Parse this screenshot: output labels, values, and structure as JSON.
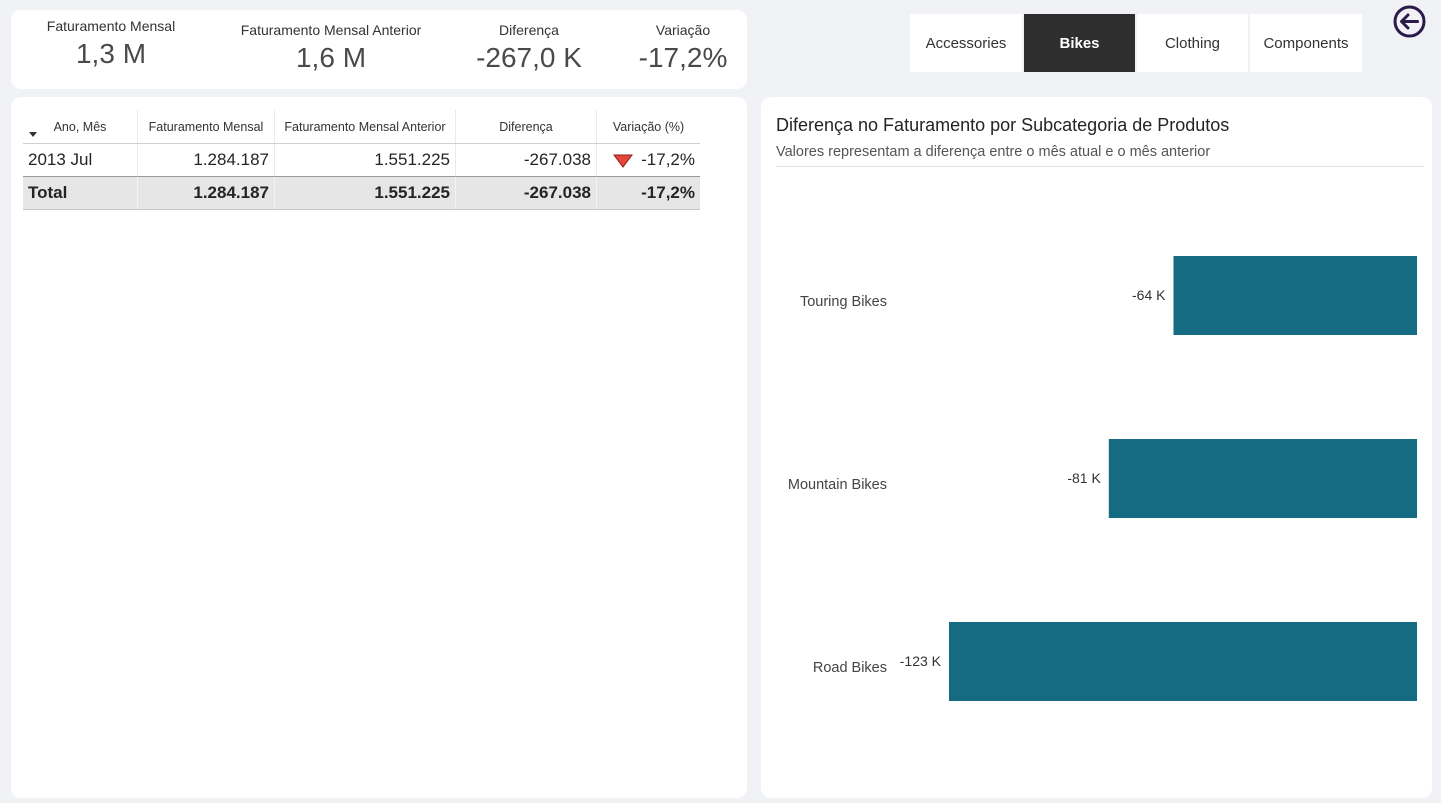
{
  "kpis": [
    {
      "label": "Faturamento Mensal",
      "value": "1,3 M"
    },
    {
      "label": "Faturamento Mensal Anterior",
      "value": "1,6 M"
    },
    {
      "label": "Diferença",
      "value": "-267,0 K"
    },
    {
      "label": "Variação",
      "value": "-17,2%"
    }
  ],
  "category_slicer": {
    "options": [
      "Accessories",
      "Bikes",
      "Clothing",
      "Components"
    ],
    "selected": "Bikes"
  },
  "back_button": {
    "icon": "arrow-left-circle-icon",
    "color": "#2b1a4a"
  },
  "table": {
    "headers": [
      "Ano, Mês",
      "Faturamento Mensal",
      "Faturamento Mensal Anterior",
      "Diferença",
      "Variação (%)"
    ],
    "rows": [
      {
        "period": "2013 Jul",
        "revenue": "1.284.187",
        "previous": "1.551.225",
        "difference": "-267.038",
        "variation": "-17,2%",
        "indicator": "down-triangle-icon"
      }
    ],
    "total": {
      "label": "Total",
      "revenue": "1.284.187",
      "previous": "1.551.225",
      "difference": "-267.038",
      "variation": "-17,2%"
    }
  },
  "chart": {
    "title": "Diferença no Faturamento por Subcategoria de Produtos",
    "subtitle": "Valores representam a diferença entre o mês atual e o mês anterior"
  },
  "chart_data": {
    "type": "bar",
    "orientation": "horizontal",
    "categories": [
      "Touring Bikes",
      "Mountain Bikes",
      "Road Bikes"
    ],
    "values": [
      -64,
      -81,
      -123
    ],
    "data_labels": [
      "-64 K",
      "-81 K",
      "-123 K"
    ],
    "unit": "K",
    "xlim": [
      -140,
      0
    ],
    "grid": false,
    "bar_color": "#156b82"
  },
  "colors": {
    "active_tile": "#2e2e2e",
    "bar": "#156b82",
    "down_indicator": "#e8463b",
    "background": "#f1f2f6"
  }
}
